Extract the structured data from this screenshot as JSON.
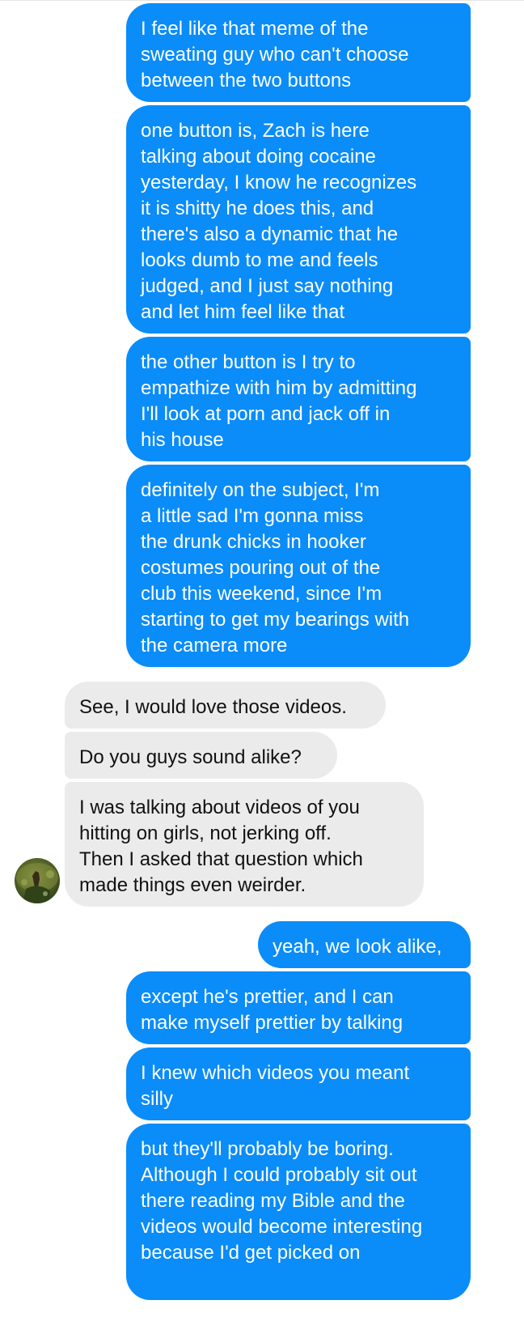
{
  "messages": [
    {
      "side": "sent",
      "text": "I feel like that meme of the\nsweating guy who can't choose\nbetween the two buttons"
    },
    {
      "side": "sent",
      "text": "one button is, Zach is here\ntalking about doing cocaine\nyesterday, I know he recognizes\nit is shitty he does this, and\nthere's also a dynamic that he\nlooks dumb to me and feels\njudged, and I just say nothing\nand let him feel like that"
    },
    {
      "side": "sent",
      "text": "the other button is I try to\nempathize with him by admitting\nI'll look at porn and jack off in\nhis house"
    },
    {
      "side": "sent",
      "text": "definitely on the subject, I'm\na little sad I'm gonna miss\nthe drunk chicks in hooker\ncostumes pouring out of the\nclub this weekend, since I'm\nstarting to get my bearings with\nthe camera more"
    },
    {
      "side": "received",
      "text": "See, I would love those videos."
    },
    {
      "side": "received",
      "text": "Do you guys sound alike?"
    },
    {
      "side": "received",
      "text": "I was talking about videos of you\nhitting on girls, not jerking off.\nThen I asked that question which\nmade things even weirder."
    },
    {
      "side": "sent",
      "text": "yeah, we look alike,"
    },
    {
      "side": "sent",
      "text": "except he's prettier, and I can\nmake myself prettier by talking"
    },
    {
      "side": "sent",
      "text": "I knew which videos you meant\nsilly"
    },
    {
      "side": "sent",
      "text": "but they'll probably be boring.\nAlthough I could probably sit out\nthere reading my Bible and the\nvideos would become interesting\nbecause I'd get picked on"
    }
  ],
  "colors": {
    "sent_bubble": "#0a8cf9",
    "received_bubble": "#ebebeb"
  },
  "icons": {
    "avatar": "contact-avatar-icon"
  }
}
